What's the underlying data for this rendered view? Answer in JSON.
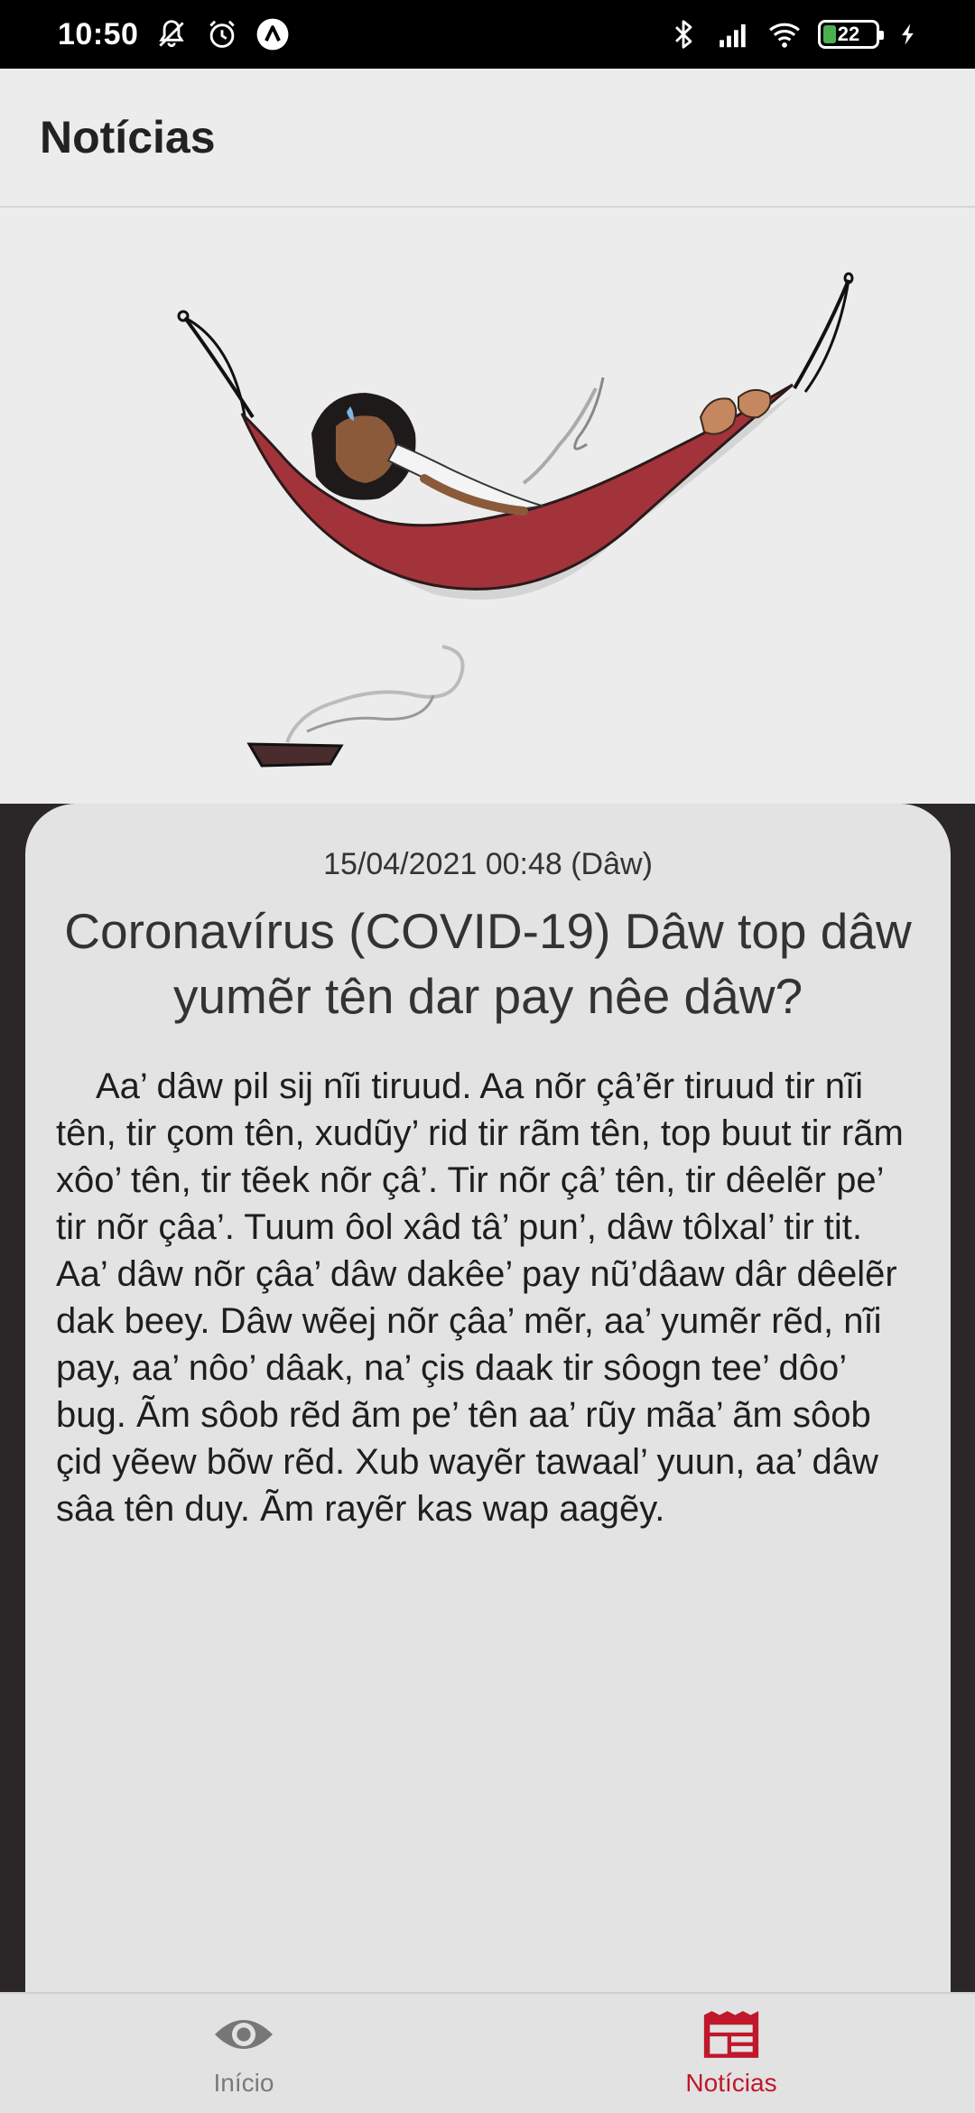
{
  "status_bar": {
    "time": "10:50",
    "battery": "22",
    "icons": [
      "muted-bell-icon",
      "alarm-icon",
      "app-badge-icon",
      "bluetooth-icon",
      "signal-icon",
      "wifi-icon",
      "battery-icon",
      "charging-icon"
    ]
  },
  "app_bar": {
    "title": "Notícias"
  },
  "article": {
    "date": "15/04/2021 00:48 (Dâw)",
    "title": "Coronavírus (COVID-19) Dâw top dâw yumẽr tên dar pay nêe dâw?",
    "body": "Aa’ dâw pil sij nĩi tiruud. Aa nõr çâ’ẽr tiruud tir nĩi tên, tir çom tên, xudũy’ rid tir rãm tên, top buut tir rãm xôo’ tên, tir tẽek nõr çâ’. Tir nõr çâ’ tên, tir dêelẽr pe’ tir nõr çâa’. Tuum ôol xâd tâ’ pun’, dâw tôlxal’ tir tit. Aa’ dâw nõr çâa’ dâw dakêe’ pay nũ’dâaw dâr dêelẽr dak beey. Dâw wẽej nõr çâa’ mẽr, aa’ yumẽr rẽd, nĩi pay, aa’ nôo’ dâak, na’ çis daak tir sôogn tee’ dôo’ bug. Ãm sôob rẽd ãm pe’ tên aa’ rũy mãa’ ãm sôob çid yẽew bõw rẽd. Xub wayẽr tawaal’ yuun, aa’ dâw sâa tên duy. Ãm rayẽr kas wap aagẽy."
  },
  "bottom_nav": {
    "items": [
      {
        "label": "Início",
        "icon": "eye-icon",
        "active": false
      },
      {
        "label": "Notícias",
        "icon": "newspaper-icon",
        "active": true
      }
    ]
  },
  "colors": {
    "accent": "#c0172c",
    "hammock": "#a3333b",
    "card_bg": "#e3e3e3",
    "page_bg": "#2b2729"
  }
}
